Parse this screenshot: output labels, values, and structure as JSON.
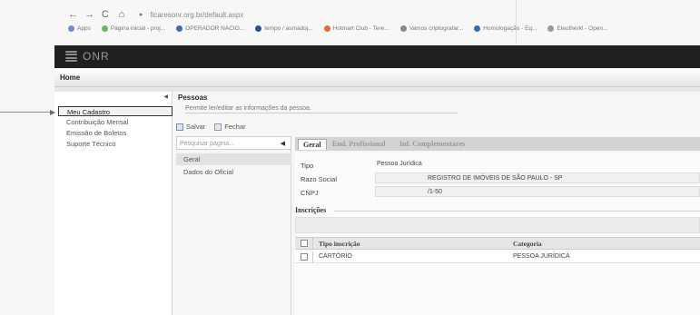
{
  "browser": {
    "url": "ficaresonr.org.br/default.aspx",
    "nav": {
      "back": "←",
      "forward": "→",
      "reload": "C",
      "home": "⌂"
    },
    "bookmarks": [
      {
        "label": "Apps",
        "color": "#6b8fd6"
      },
      {
        "label": "Página inicial - proj...",
        "color": "#6bb36b"
      },
      {
        "label": "OPERADOR NACIO...",
        "color": "#3b6fb0"
      },
      {
        "label": "tempo / asmadoj...",
        "color": "#2e4f96"
      },
      {
        "label": "Hotmart Club - Tere...",
        "color": "#e07030"
      },
      {
        "label": "Vamos criptografar...",
        "color": "#8a8a8a"
      },
      {
        "label": "Homologação - Eq...",
        "color": "#2c6fb7"
      },
      {
        "label": "Eleutherkl - Open...",
        "color": "#9a9a9a"
      }
    ]
  },
  "app": {
    "logo": "ONR",
    "home_tab": "Home"
  },
  "sidebar": {
    "items": [
      {
        "label": "Meu Cadastro",
        "active": true
      },
      {
        "label": "Contribuição Mensal"
      },
      {
        "label": "Emissão de Boletos"
      },
      {
        "label": "Suporte Técnico"
      }
    ]
  },
  "page": {
    "title": "Pessoas",
    "description": "Permite ler/editar as informações da pessoa.",
    "toolbar": {
      "save": "Salvar",
      "close": "Fechar"
    }
  },
  "subnav": {
    "search_placeholder": "Pesquisar página...",
    "items": [
      {
        "label": "Geral",
        "active": true
      },
      {
        "label": "Dados do Oficial"
      }
    ]
  },
  "tabs": [
    {
      "label": "Geral",
      "active": true
    },
    {
      "label": "End. Profissional"
    },
    {
      "label": "Inf. Complementares"
    }
  ],
  "form": {
    "tipo_label": "Tipo",
    "tipo_value": "Pessoa Jurídica",
    "razao_label": "Razo Social",
    "razao_value": "REGISTRO DE IMÓVEIS DE SÃO PAULO - SP",
    "cnpj_label": "CNPJ",
    "cnpj_value": "/1-50"
  },
  "inscricoes": {
    "section_label": "Inscrições",
    "columns": [
      "Tipo inscrição",
      "Categoria"
    ],
    "rows": [
      [
        "CARTÓRIO",
        "PESSOA JURÍDICA"
      ]
    ]
  }
}
